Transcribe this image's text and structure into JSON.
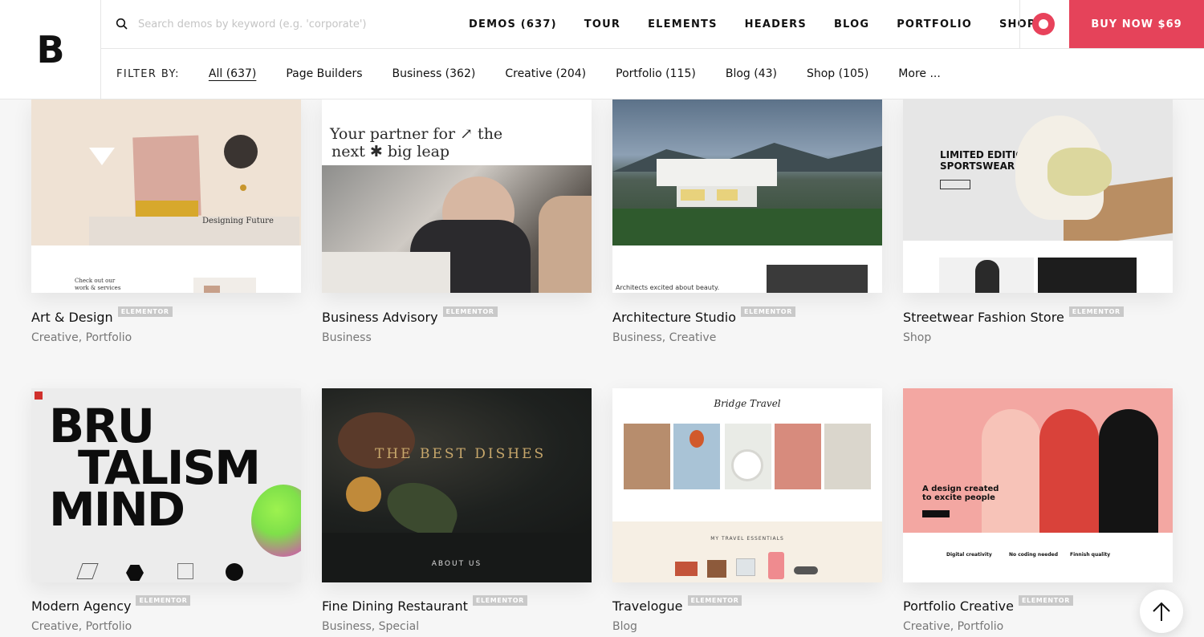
{
  "logo": "B",
  "search": {
    "placeholder": "Search demos by keyword (e.g. 'corporate')"
  },
  "nav": [
    "DEMOS (637)",
    "TOUR",
    "ELEMENTS",
    "HEADERS",
    "BLOG",
    "PORTFOLIO",
    "SHOP"
  ],
  "buy_label": "BUY NOW $69",
  "filter_label": "FILTER BY:",
  "filters": [
    "All (637)",
    "Page Builders",
    "Business (362)",
    "Creative (204)",
    "Portfolio (115)",
    "Blog (43)",
    "Shop (105)",
    "More ..."
  ],
  "badge": "ELEMENTOR",
  "cards": [
    {
      "title": "Art & Design",
      "cats": "Creative,  Portfolio",
      "thumb": {
        "a": "Designing Future",
        "b": "Check out our work & services"
      }
    },
    {
      "title": "Business Advisory",
      "cats": "Business",
      "thumb": {
        "a": "Your partner for ↗ the",
        "b": "next ✱ big leap"
      }
    },
    {
      "title": "Architecture Studio",
      "cats": "Business,  Creative",
      "thumb": {
        "a": "Architects excited about beauty."
      }
    },
    {
      "title": "Streetwear Fashion Store",
      "cats": "Shop",
      "thumb": {
        "a": "LIMITED EDITION",
        "b": "SPORTSWEAR"
      }
    },
    {
      "title": "Modern Agency",
      "cats": "Creative,  Portfolio",
      "thumb": {
        "a": "BRU",
        "b": "TALISM",
        "c": "MIND"
      }
    },
    {
      "title": "Fine Dining Restaurant",
      "cats": "Business,  Special",
      "thumb": {
        "a": "THE BEST DISHES",
        "b": "ABOUT US"
      }
    },
    {
      "title": "Travelogue",
      "cats": "Blog",
      "thumb": {
        "a": "Bridge Travel",
        "b": "MY TRAVEL ESSENTIALS"
      }
    },
    {
      "title": "Portfolio Creative",
      "cats": "Creative,  Portfolio",
      "thumb": {
        "a": "A design created to excite people",
        "b": "Digital creativity",
        "c": "No coding needed",
        "d": "Finnish quality"
      }
    }
  ],
  "colors": {
    "accent": "#e5435a",
    "badge": "#c9c9c9"
  }
}
